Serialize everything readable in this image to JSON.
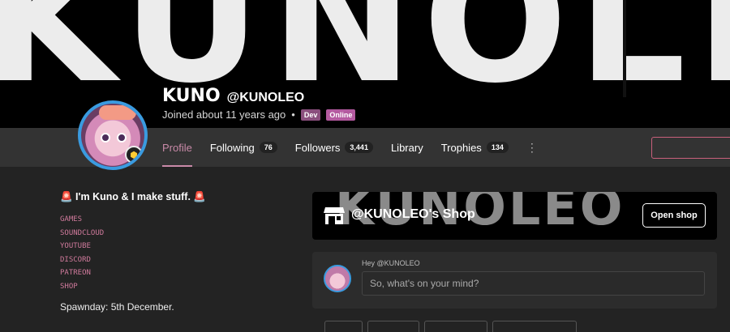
{
  "banner": {
    "text": "KUNOLEO"
  },
  "profile": {
    "display_name": "KUNO",
    "handle": "@KUNOLEO",
    "joined": "Joined about 11 years ago",
    "separator": "•",
    "tags": {
      "dev": "Dev",
      "online": "Online"
    }
  },
  "tabs": [
    {
      "label": "Profile",
      "active": true
    },
    {
      "label": "Following",
      "count": "76"
    },
    {
      "label": "Followers",
      "count": "3,441"
    },
    {
      "label": "Library"
    },
    {
      "label": "Trophies",
      "count": "134"
    }
  ],
  "more_glyph": "⋮",
  "bio": {
    "title": "🚨 I'm Kuno & I make stuff. 🚨",
    "links": [
      "GAMES",
      "SOUNDCLOUD",
      "YOUTUBE",
      "DISCORD",
      "PATREON",
      "SHOP"
    ],
    "spawnday": "Spawnday: 5th December."
  },
  "shop": {
    "background_text": "KUNOLEO",
    "title": "@KUNOLEO's Shop",
    "button": "Open shop"
  },
  "compose": {
    "greeting": "Hey @KUNOLEO",
    "placeholder": "So, what's on your mind?"
  },
  "colors": {
    "accent": "#c98aa8",
    "avatar_ring": "#3a9be0",
    "banner": "#000000",
    "nav": "#333333"
  }
}
